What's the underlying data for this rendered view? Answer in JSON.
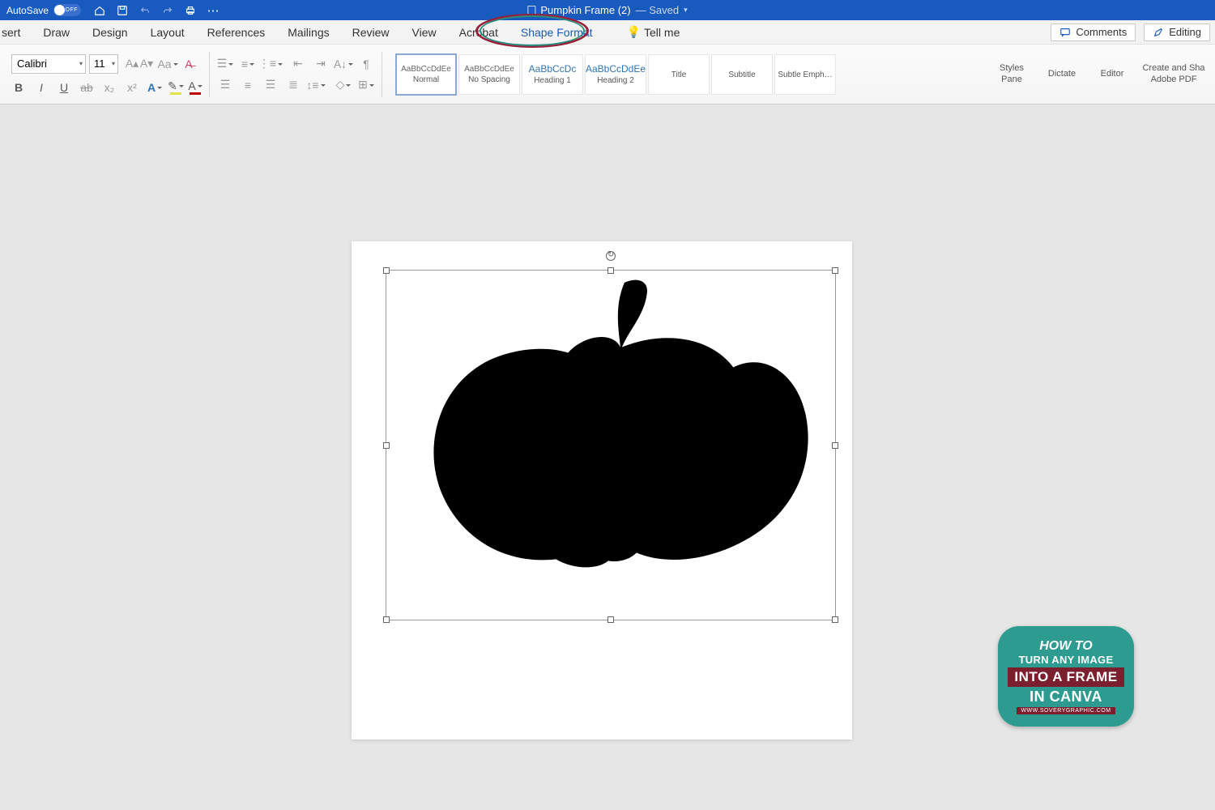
{
  "titlebar": {
    "autosave_label": "AutoSave",
    "autosave_off": "OFF",
    "doc_name": "Pumpkin Frame (2)",
    "saved_label": " — Saved"
  },
  "tabs": {
    "items": [
      "sert",
      "Draw",
      "Design",
      "Layout",
      "References",
      "Mailings",
      "Review",
      "View",
      "Acrobat",
      "Shape Format"
    ],
    "tell_me": "Tell me",
    "comments": "Comments",
    "editing": "Editing"
  },
  "font": {
    "name": "Calibri",
    "size": "11"
  },
  "styles": [
    {
      "preview": "AaBbCcDdEe",
      "label": "Normal"
    },
    {
      "preview": "AaBbCcDdEe",
      "label": "No Spacing"
    },
    {
      "preview": "AaBbCcDc",
      "label": "Heading 1"
    },
    {
      "preview": "AaBbCcDdEe",
      "label": "Heading 2"
    },
    {
      "preview": "",
      "label": "Title"
    },
    {
      "preview": "",
      "label": "Subtitle"
    },
    {
      "preview": "",
      "label": "Subtle Emph…"
    }
  ],
  "ribbon_right": {
    "styles_pane": "Styles\nPane",
    "dictate": "Dictate",
    "editor": "Editor",
    "create_pdf": "Create and Sha\nAdobe PDF"
  },
  "badge": {
    "l1": "HOW TO",
    "l2": "TURN ANY IMAGE",
    "l3": "INTO A FRAME",
    "l4": "IN CANVA",
    "l5": "WWW.SOVERYGRAPHIC.COM"
  }
}
